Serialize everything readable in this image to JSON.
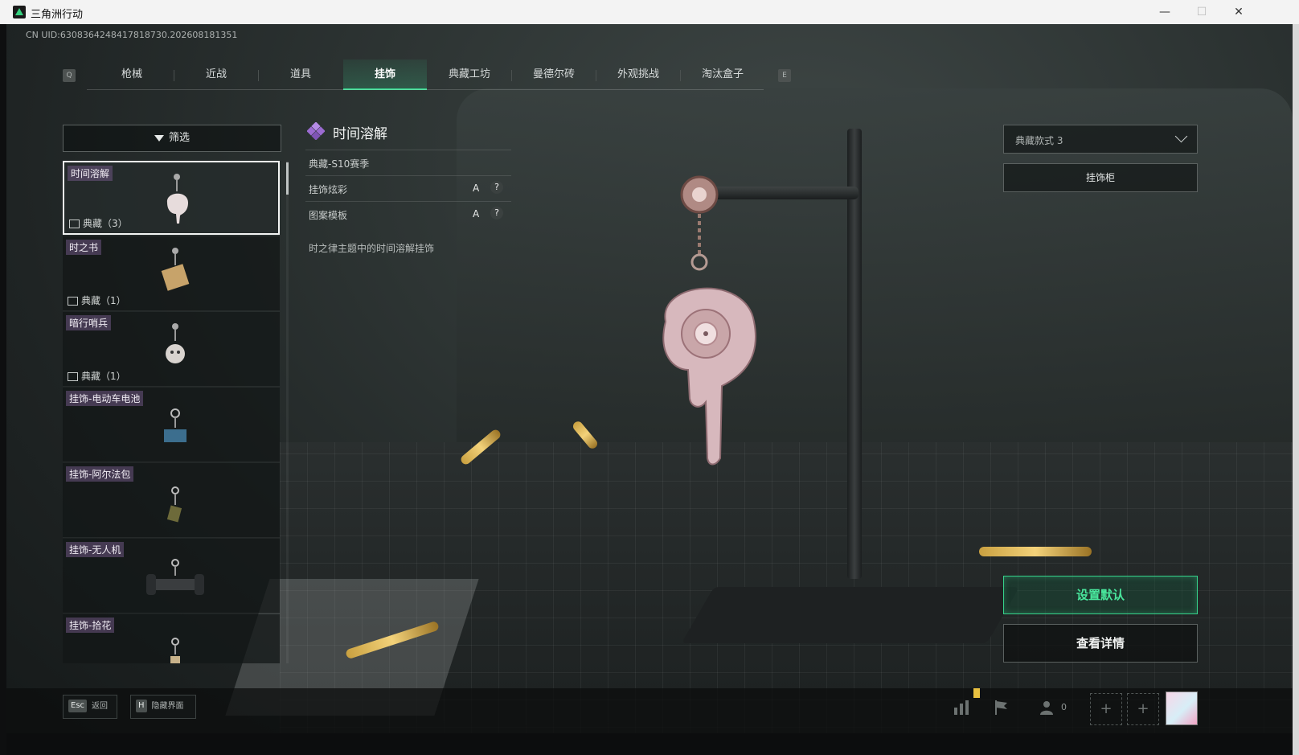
{
  "window": {
    "title": "三角洲行动",
    "minimize": "—",
    "maximize": "☐",
    "close": "✕"
  },
  "uid_text": "CN UID:6308364248417818730.202608181351",
  "tabs": {
    "prev_key": "Q",
    "next_key": "E",
    "items": [
      {
        "label": "枪械",
        "active": false
      },
      {
        "label": "近战",
        "active": false
      },
      {
        "label": "道具",
        "active": false
      },
      {
        "label": "挂饰",
        "active": true
      },
      {
        "label": "典藏工坊",
        "active": false
      },
      {
        "label": "曼德尔砖",
        "active": false
      },
      {
        "label": "外观挑战",
        "active": false
      },
      {
        "label": "淘汰盒子",
        "active": false
      }
    ]
  },
  "filter": {
    "label": "筛选"
  },
  "items": [
    {
      "name": "时间溶解",
      "tier": "典藏（3）",
      "selected": true
    },
    {
      "name": "时之书",
      "tier": "典藏（1）",
      "selected": false
    },
    {
      "name": "暗行哨兵",
      "tier": "典藏（1）",
      "selected": false
    },
    {
      "name": "挂饰-电动车电池",
      "tier": "",
      "selected": false
    },
    {
      "name": "挂饰-阿尔法包",
      "tier": "",
      "selected": false
    },
    {
      "name": "挂饰-无人机",
      "tier": "",
      "selected": false
    },
    {
      "name": "挂饰-拾花",
      "tier": "",
      "selected": false
    }
  ],
  "detail": {
    "title": "时间溶解",
    "season": "典藏-S10赛季",
    "rows": [
      {
        "label": "挂饰炫彩",
        "grade": "A",
        "help": "?"
      },
      {
        "label": "图案模板",
        "grade": "A",
        "help": "?"
      }
    ],
    "description": "时之律主题中的时间溶解挂饰"
  },
  "style_select": {
    "value": "典藏款式 3"
  },
  "buttons": {
    "cabinet": "挂饰柜",
    "set_default": "设置默认",
    "view_details": "查看详情"
  },
  "bottom_bar": {
    "esc_key": "Esc",
    "esc_label": "返回",
    "h_key": "H",
    "h_label": "隐藏界面",
    "friend_count": "0",
    "plus": "+"
  },
  "colors": {
    "accent": "#37d58e",
    "rarity_purple": "#9b6bd1",
    "text_light": "#e6e9e8"
  }
}
